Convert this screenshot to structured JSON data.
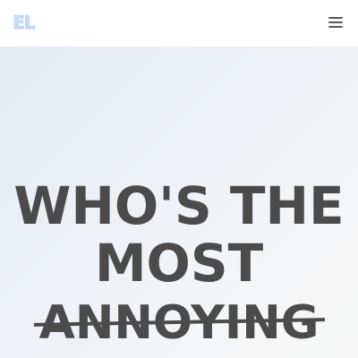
{
  "header": {
    "logo_text": "EL",
    "menu_icon": "hamburger-menu-icon"
  },
  "hero": {
    "headline_line1": "WHO'S THE",
    "headline_line2": "MOST",
    "headline_line3": "ANNOYING"
  },
  "colors": {
    "logo": "#c7dcf6",
    "headline": "#4b4b4b",
    "hero_bg_start": "#e4ebf3",
    "hero_bg_end": "#f7f7f7"
  }
}
